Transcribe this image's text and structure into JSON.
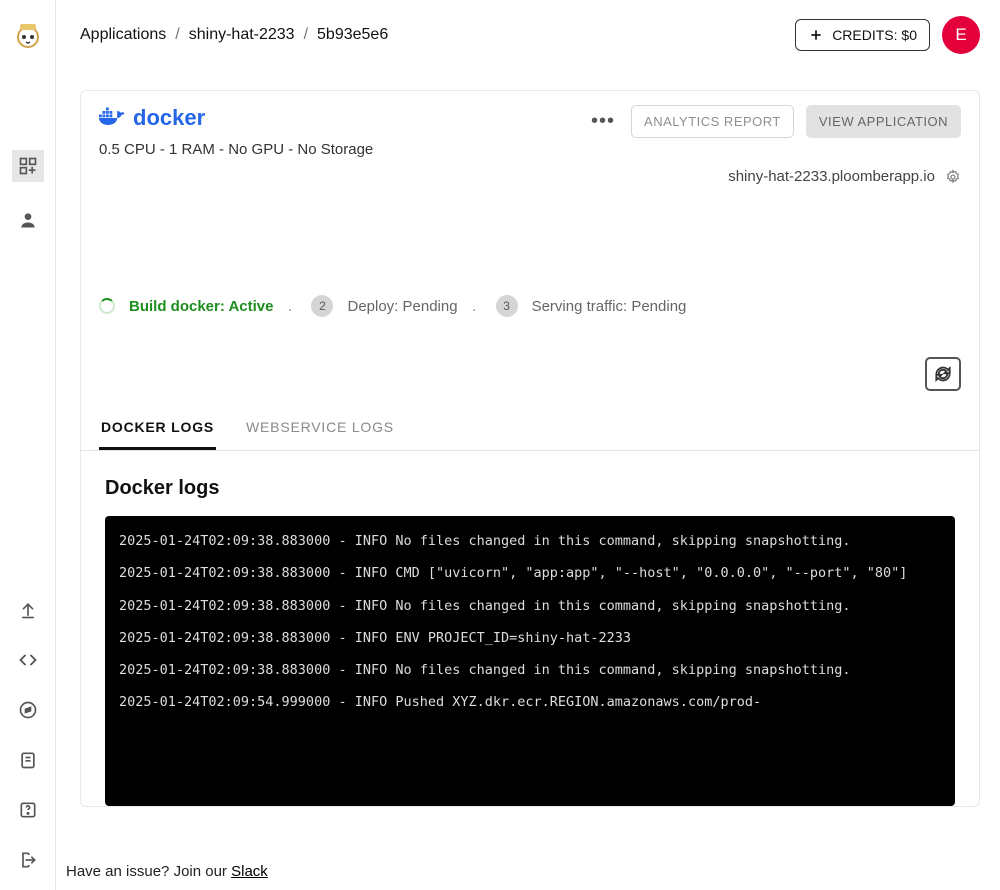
{
  "breadcrumb": {
    "root": "Applications",
    "project": "shiny-hat-2233",
    "commit": "5b93e5e6"
  },
  "header": {
    "credits_label": "CREDITS: $0",
    "avatar_initial": "E"
  },
  "deployment": {
    "framework_label": "docker",
    "spec_line": "0.5 CPU - 1 RAM - No GPU - No Storage",
    "analytics_btn": "ANALYTICS REPORT",
    "view_app_btn": "VIEW APPLICATION",
    "app_url": "shiny-hat-2233.ploomberapp.io",
    "steps": {
      "build": "Build docker: Active",
      "deploy": {
        "badge": "2",
        "label": "Deploy: Pending"
      },
      "traffic": {
        "badge": "3",
        "label": "Serving traffic: Pending"
      }
    }
  },
  "log_tabs": {
    "docker": "DOCKER LOGS",
    "webservice": "WEBSERVICE LOGS"
  },
  "logs": {
    "title": "Docker logs",
    "lines": [
      "2025-01-24T02:09:38.883000 - INFO No files changed in this command, skipping snapshotting.",
      "2025-01-24T02:09:38.883000 - INFO CMD [\"uvicorn\", \"app:app\", \"--host\", \"0.0.0.0\", \"--port\", \"80\"]",
      "2025-01-24T02:09:38.883000 - INFO No files changed in this command, skipping snapshotting.",
      "2025-01-24T02:09:38.883000 - INFO ENV PROJECT_ID=shiny-hat-2233",
      "2025-01-24T02:09:38.883000 - INFO No files changed in this command, skipping snapshotting.",
      "2025-01-24T02:09:54.999000 - INFO Pushed XYZ.dkr.ecr.REGION.amazonaws.com/prod-"
    ]
  },
  "footer": {
    "text": "Have an issue? Join our ",
    "link": "Slack"
  }
}
